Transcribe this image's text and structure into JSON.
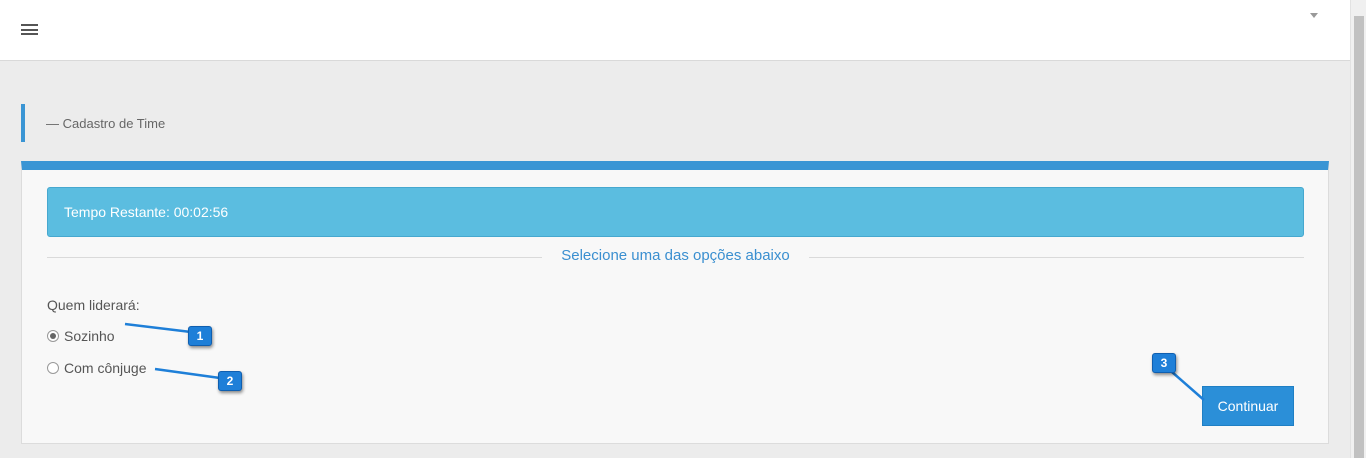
{
  "page": {
    "header_title": "— Cadastro de Time"
  },
  "timer": {
    "label": "Tempo Restante: 00:02:56"
  },
  "section": {
    "divider_text": "Selecione uma das opções abaixo"
  },
  "form": {
    "question": "Quem liderará:",
    "options": [
      {
        "label": "Sozinho",
        "checked": true
      },
      {
        "label": "Com cônjuge",
        "checked": false
      }
    ],
    "continue_label": "Continuar"
  },
  "annotations": [
    {
      "label": "1"
    },
    {
      "label": "2"
    },
    {
      "label": "3"
    }
  ],
  "colors": {
    "accent": "#3a95d4",
    "timer_bg": "#5bbde0",
    "button": "#2b8fd8",
    "annotation": "#1e7fd8"
  }
}
